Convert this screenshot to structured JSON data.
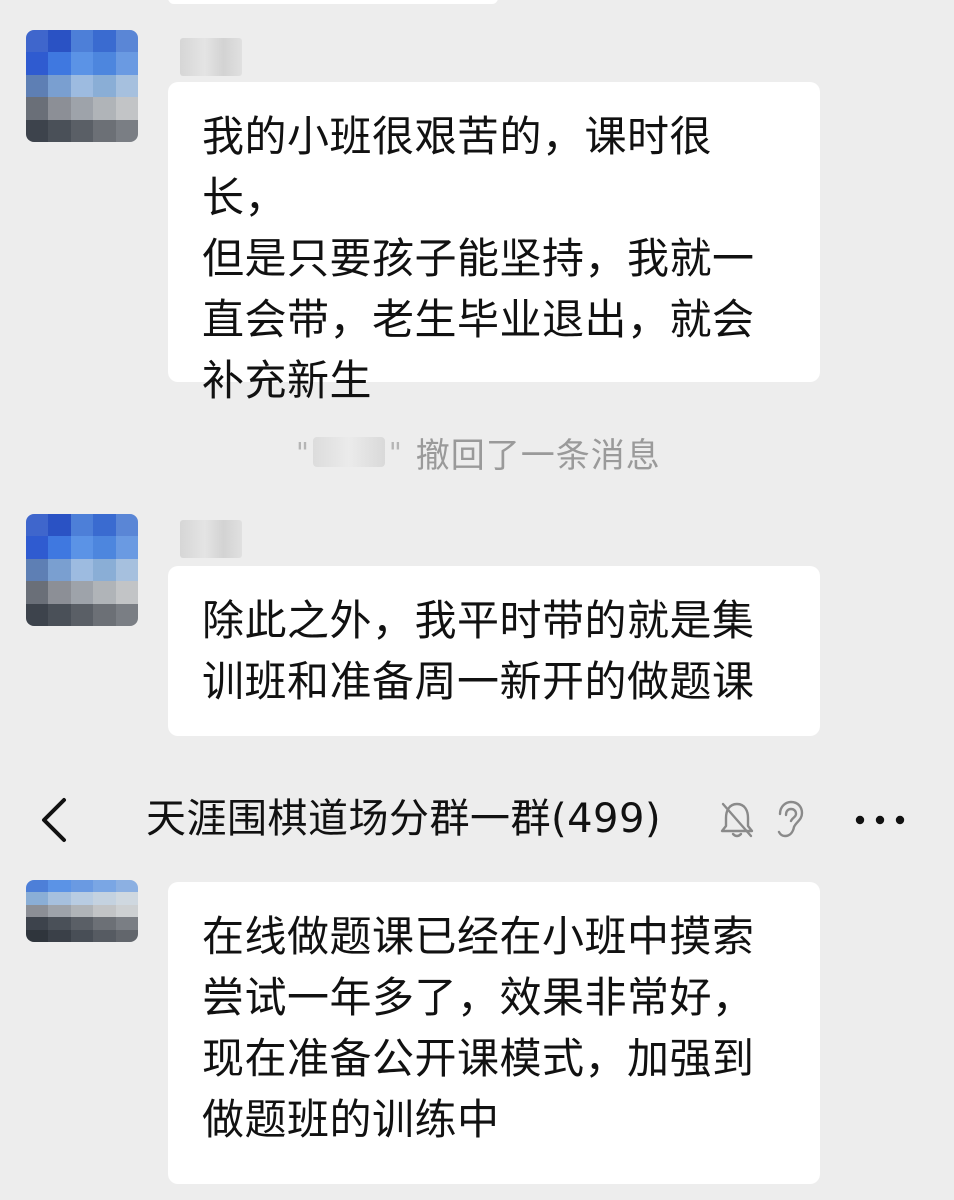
{
  "messages": [
    {
      "text": "我的小班很艰苦的，课时很长，\n但是只要孩子能坚持，我就一\n直会带，老生毕业退出，就会\n补充新生"
    },
    {
      "text": "除此之外，我平时带的就是集\n训班和准备周一新开的做题课"
    },
    {
      "text": "在线做题课已经在小班中摸索\n尝试一年多了，效果非常好，\n现在准备公开课模式，加强到\n做题班的训练中"
    }
  ],
  "system_notice": {
    "open_quote": "\"",
    "close_quote": "\"",
    "text": "撤回了一条消息"
  },
  "header": {
    "title": "天涯围棋道场分群一群(499)",
    "back_icon": "chevron-left-icon",
    "mute_icon": "bell-off-icon",
    "ear_icon": "earpiece-icon",
    "more_icon": "more-dots-icon"
  },
  "colors": {
    "background": "#ededed",
    "bubble": "#ffffff",
    "text": "#111111",
    "system_text": "#9a9a9a"
  }
}
